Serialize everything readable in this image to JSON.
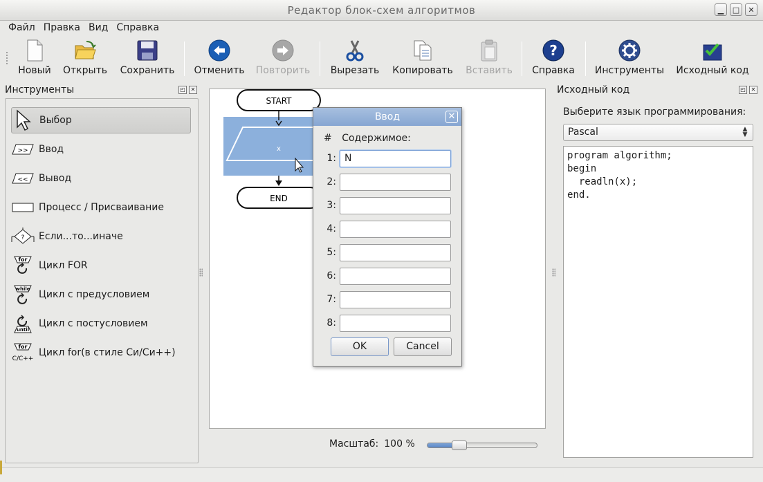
{
  "window": {
    "title": "Редактор блок-схем алгоритмов"
  },
  "menu": [
    "Файл",
    "Правка",
    "Вид",
    "Справка"
  ],
  "toolbar": [
    {
      "label": "Новый",
      "icon": "new-document-icon",
      "enabled": true
    },
    {
      "label": "Открыть",
      "icon": "open-folder-icon",
      "enabled": true
    },
    {
      "label": "Сохранить",
      "icon": "save-floppy-icon",
      "enabled": true
    },
    {
      "label": "Отменить",
      "icon": "undo-arrow-icon",
      "enabled": true
    },
    {
      "label": "Повторить",
      "icon": "redo-arrow-icon",
      "enabled": false
    },
    {
      "label": "Вырезать",
      "icon": "cut-scissors-icon",
      "enabled": true
    },
    {
      "label": "Копировать",
      "icon": "copy-icon",
      "enabled": true
    },
    {
      "label": "Вставить",
      "icon": "paste-icon",
      "enabled": false
    },
    {
      "label": "Справка",
      "icon": "help-icon",
      "enabled": true
    },
    {
      "label": "Инструменты",
      "icon": "gear-icon",
      "enabled": true
    },
    {
      "label": "Исходный код",
      "icon": "source-code-icon",
      "enabled": true
    }
  ],
  "tools_panel": {
    "title": "Инструменты",
    "items": [
      {
        "label": "Выбор",
        "icon": "pointer-arrow-icon",
        "selected": true
      },
      {
        "label": "Ввод",
        "icon": "input-parallelogram-icon",
        "selected": false
      },
      {
        "label": "Вывод",
        "icon": "output-parallelogram-icon",
        "selected": false
      },
      {
        "label": "Процесс / Присваивание",
        "icon": "process-rectangle-icon",
        "selected": false
      },
      {
        "label": "Если...то...иначе",
        "icon": "if-diamond-icon",
        "selected": false
      },
      {
        "label": "Цикл FOR",
        "icon": "for-loop-icon",
        "selected": false
      },
      {
        "label": "Цикл с предусловием",
        "icon": "while-loop-icon",
        "selected": false
      },
      {
        "label": "Цикл с постусловием",
        "icon": "until-loop-icon",
        "selected": false
      },
      {
        "label": "Цикл for(в стиле Си/Си++)",
        "icon": "c-for-loop-icon",
        "selected": false
      }
    ]
  },
  "flowchart": {
    "start_label": "START",
    "io_label": "x",
    "end_label": "END"
  },
  "icon_text": {
    "input": ">>",
    "output": "<<",
    "if": "?",
    "for": "for",
    "while": "while",
    "until": "until",
    "cfor_top": "for",
    "cfor_bottom": "C/C++"
  },
  "zoom": {
    "label": "Масштаб:",
    "value": "100 %",
    "level": 0.25
  },
  "dialog": {
    "title": "Ввод",
    "hash_header": "#",
    "content_header": "Содержимое:",
    "rows": [
      {
        "num": "1:",
        "value": "N"
      },
      {
        "num": "2:",
        "value": ""
      },
      {
        "num": "3:",
        "value": ""
      },
      {
        "num": "4:",
        "value": ""
      },
      {
        "num": "5:",
        "value": ""
      },
      {
        "num": "6:",
        "value": ""
      },
      {
        "num": "7:",
        "value": ""
      },
      {
        "num": "8:",
        "value": ""
      }
    ],
    "ok_label": "OK",
    "cancel_label": "Cancel"
  },
  "source_panel": {
    "title": "Исходный код",
    "language_label": "Выберите язык программирования:",
    "language": "Pascal",
    "code_lines": [
      "program algorithm;",
      "begin",
      "  readln(x);",
      "end."
    ]
  },
  "colors": {
    "selection_fill": "#8cb0dc",
    "dialog_title": "#8eaad4",
    "accent": "#1b5fb5"
  }
}
